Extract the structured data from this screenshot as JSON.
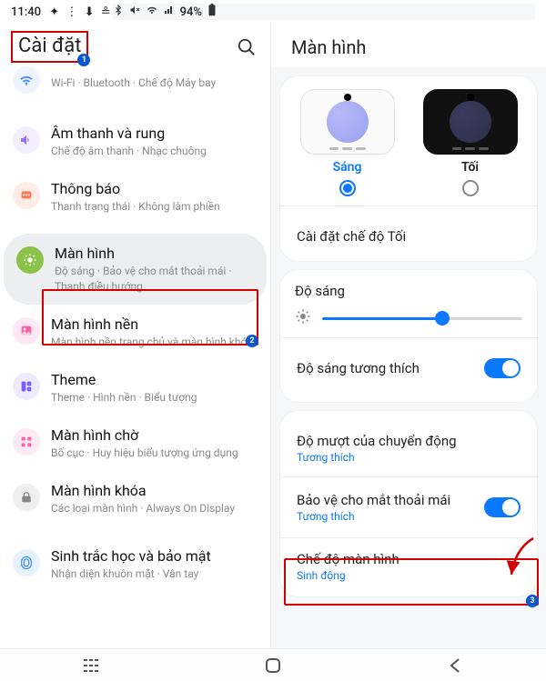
{
  "statusbar": {
    "time": "11:40",
    "battery": "94%"
  },
  "left": {
    "title": "Cài đặt",
    "items": [
      {
        "icon": "connections",
        "title": "",
        "sub": "Wi-Fi  ·  Bluetooth  ·  Chế độ Máy bay"
      },
      {
        "icon": "sound",
        "title": "Âm thanh và rung",
        "sub": "Chế độ âm thanh  ·  Nhạc chuông"
      },
      {
        "icon": "notif",
        "title": "Thông báo",
        "sub": "Thanh trạng thái  ·  Không làm phiền"
      },
      {
        "icon": "display",
        "title": "Màn hình",
        "sub": "Độ sáng  ·  Bảo vệ cho mắt thoải mái  ·  Thanh điều hướng",
        "selected": true
      },
      {
        "icon": "wallpaper",
        "title": "Màn hình nền",
        "sub": "Màn hình nền trang chủ và màn hình khóa"
      },
      {
        "icon": "theme",
        "title": "Theme",
        "sub": "Theme  ·  Hình nền  ·  Biểu tượng"
      },
      {
        "icon": "home",
        "title": "Màn hình chờ",
        "sub": "Bố cục  ·  Huy hiệu biểu tượng ứng dụng"
      },
      {
        "icon": "lock",
        "title": "Màn hình khóa",
        "sub": "Các loại màn hình  ·  Always On Display"
      },
      {
        "icon": "biometric",
        "title": "Sinh trắc học và bảo mật",
        "sub": "Nhận diện khuôn mặt  ·  Vân tay"
      }
    ]
  },
  "right": {
    "title": "Màn hình",
    "theme": {
      "light_label": "Sáng",
      "dark_label": "Tối",
      "dark_mode_settings": "Cài đặt chế độ Tối"
    },
    "brightness": {
      "title": "Độ sáng",
      "adaptive": "Độ sáng tương thích"
    },
    "motion": {
      "title": "Độ mượt của chuyển động",
      "sub": "Tương thích"
    },
    "eyecomfort": {
      "title": "Bảo vệ cho mắt thoải mái",
      "sub": "Tương thích"
    },
    "screenmode": {
      "title": "Chế độ màn hình",
      "sub": "Sinh động"
    }
  }
}
